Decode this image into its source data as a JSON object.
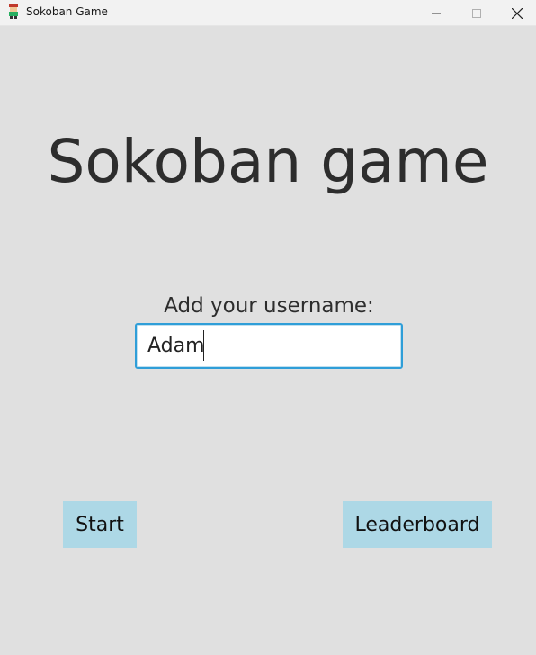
{
  "window": {
    "title": "Sokoban Game",
    "icon": "sokoban-app-icon",
    "controls": [
      "minimize-icon",
      "maximize-icon",
      "close-icon"
    ]
  },
  "main": {
    "heading": "Sokoban game",
    "username_label": "Add your username:",
    "username_value": "Adam",
    "start_label": "Start",
    "leaderboard_label": "Leaderboard"
  },
  "colors": {
    "background": "#e0e0e0",
    "button": "#add8e6",
    "input_border": "#2f9ed8",
    "text": "#2d2d2d"
  }
}
